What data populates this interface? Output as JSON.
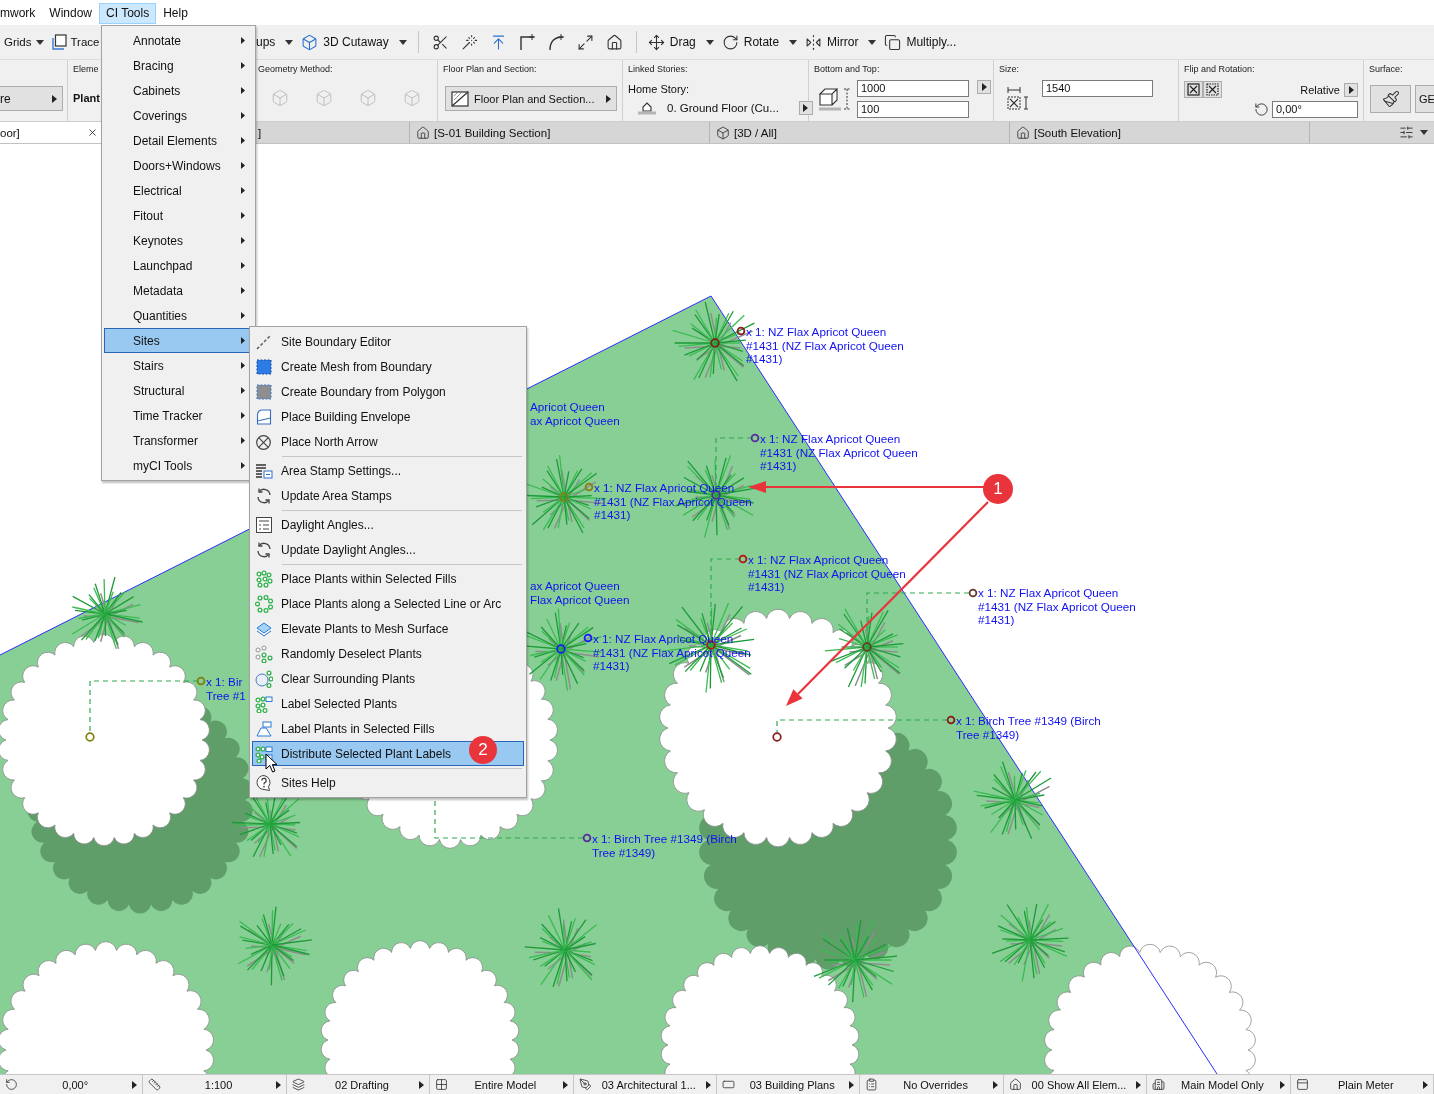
{
  "menu_bar": [
    {
      "label": "mwork",
      "selected": false
    },
    {
      "label": "Window",
      "selected": false
    },
    {
      "label": "CI Tools",
      "selected": true
    },
    {
      "label": "Help",
      "selected": false
    }
  ],
  "toolbar": [
    {
      "label": "Grids",
      "dropdown": true
    },
    {
      "label": "Trace",
      "dropdown": false
    },
    {
      "label": "ups",
      "dropdown": true
    },
    {
      "label": "3D Cutaway",
      "dropdown": true
    },
    {
      "label": "Drag",
      "dropdown": true
    },
    {
      "label": "Rotate",
      "dropdown": true
    },
    {
      "label": "Mirror",
      "dropdown": true
    },
    {
      "label": "Multiply...",
      "dropdown": false
    }
  ],
  "info_box": [
    {
      "kind": "selector",
      "value": "re"
    },
    {
      "kind": "element",
      "heading": "Eleme",
      "value": "Plant"
    },
    {
      "kind": "geometry",
      "heading": "Geometry Method:",
      "disabled": true
    },
    {
      "kind": "popup",
      "heading": "Floor Plan and Section:",
      "value": "Floor Plan and Section..."
    },
    {
      "kind": "story",
      "heading": "Linked Stories:",
      "label": "Home Story:",
      "value": "0. Ground Floor (Cu..."
    },
    {
      "kind": "bottom_top",
      "heading": "Bottom and Top:",
      "fields": [
        "1000",
        "100"
      ]
    },
    {
      "kind": "size",
      "heading": "Size:",
      "fields": [
        "1540"
      ]
    },
    {
      "kind": "flip",
      "heading": "Flip and Rotation:",
      "mode": "Relative",
      "fields": [
        "0,00°"
      ]
    },
    {
      "kind": "surface",
      "heading": "Surface:",
      "value": "GE"
    }
  ],
  "tabs": [
    {
      "label": "oor]",
      "selected": true,
      "closable": true
    },
    {
      "label": "]",
      "selected": false,
      "closable": false
    },
    {
      "label": "[S-01 Building Section]",
      "selected": false,
      "closable": false
    },
    {
      "label": "[3D / All]",
      "selected": false,
      "closable": false
    },
    {
      "label": "[South Elevation]",
      "selected": false,
      "closable": false
    }
  ],
  "canvas": {
    "labels": [
      {
        "lines": [
          "x 1: NZ Flax Apricot Queen",
          "#1431 (NZ Flax Apricot Queen",
          "#1431)"
        ],
        "color": "#8b1a1a"
      },
      {
        "lines": [
          "Apricot Queen",
          "ax Apricot Queen"
        ]
      },
      {
        "lines": [
          "x 1: NZ Flax Apricot Queen",
          "#1431 (NZ Flax Apricot Queen",
          "#1431)"
        ],
        "color": "#5b2ca0"
      },
      {
        "lines": [
          "x 1: NZ Flax Apricot Queen",
          "#1431 (NZ Flax Apricot Queen",
          "#1431)"
        ],
        "color": "#8a7d10"
      },
      {
        "lines": [
          "x 1: NZ Flax Apricot Queen",
          "#1431 (NZ Flax Apricot Queen",
          "#1431)"
        ],
        "color": "#b01818"
      },
      {
        "lines": [
          "x 1: NZ Flax Apricot Queen",
          "#1431 (NZ Flax Apricot Queen",
          "#1431)"
        ],
        "color": "#6b3a2a"
      },
      {
        "lines": [
          "ax Apricot Queen",
          "Flax Apricot Queen"
        ]
      },
      {
        "lines": [
          "x 1: NZ Flax Apricot Queen",
          "#1431 (NZ Flax Apricot Queen",
          "#1431)"
        ],
        "color": "#1a1aff"
      },
      {
        "lines": [
          "x 1: Bir",
          "Tree #1"
        ],
        "color": "#808010"
      },
      {
        "lines": [
          "x 1: Birch Tree #1349 (Birch",
          "Tree #1349)"
        ],
        "color": "#8b1a1a"
      },
      {
        "lines": [
          "x 1: Birch Tree #1349 (Birch",
          "Tree #1349)"
        ],
        "color": "#5b2ca0"
      }
    ]
  },
  "ci_tools_menu": [
    {
      "label": "Annotate",
      "submenu": true,
      "selected": false
    },
    {
      "label": "Bracing",
      "submenu": true,
      "selected": false
    },
    {
      "label": "Cabinets",
      "submenu": true,
      "selected": false
    },
    {
      "label": "Coverings",
      "submenu": true,
      "selected": false
    },
    {
      "label": "Detail Elements",
      "submenu": true,
      "selected": false
    },
    {
      "label": "Doors+Windows",
      "submenu": true,
      "selected": false
    },
    {
      "label": "Electrical",
      "submenu": true,
      "selected": false
    },
    {
      "label": "Fitout",
      "submenu": true,
      "selected": false
    },
    {
      "label": "Keynotes",
      "submenu": true,
      "selected": false
    },
    {
      "label": "Launchpad",
      "submenu": true,
      "selected": false
    },
    {
      "label": "Metadata",
      "submenu": true,
      "selected": false
    },
    {
      "label": "Quantities",
      "submenu": true,
      "selected": false
    },
    {
      "label": "Sites",
      "submenu": true,
      "selected": true
    },
    {
      "label": "Stairs",
      "submenu": true,
      "selected": false
    },
    {
      "label": "Structural",
      "submenu": true,
      "selected": false
    },
    {
      "label": "Time Tracker",
      "submenu": true,
      "selected": false
    },
    {
      "label": "Transformer",
      "submenu": true,
      "selected": false
    },
    {
      "label": "myCI Tools",
      "submenu": true,
      "selected": false
    }
  ],
  "sites_submenu": {
    "sections": [
      {
        "items": [
          {
            "label": "Site Boundary Editor",
            "selected": false
          },
          {
            "label": "Create Mesh from Boundary",
            "selected": false
          },
          {
            "label": "Create Boundary from Polygon",
            "selected": false
          },
          {
            "label": "Place Building Envelope",
            "selected": false
          },
          {
            "label": "Place North Arrow",
            "selected": false
          }
        ]
      },
      {
        "items": [
          {
            "label": "Area Stamp Settings...",
            "selected": false
          },
          {
            "label": "Update Area Stamps",
            "selected": false
          }
        ]
      },
      {
        "items": [
          {
            "label": "Daylight Angles...",
            "selected": false
          },
          {
            "label": "Update Daylight Angles...",
            "selected": false
          }
        ]
      },
      {
        "items": [
          {
            "label": "Place Plants within Selected Fills",
            "selected": false
          },
          {
            "label": "Place Plants along a Selected Line or Arc",
            "selected": false
          },
          {
            "label": "Elevate Plants to Mesh Surface",
            "selected": false
          },
          {
            "label": "Randomly Deselect Plants",
            "selected": false
          },
          {
            "label": "Clear Surrounding Plants",
            "selected": false
          },
          {
            "label": "Label Selected Plants",
            "selected": false
          },
          {
            "label": "Label Plants in Selected Fills",
            "selected": false
          },
          {
            "label": "Distribute Selected Plant Labels",
            "selected": true
          }
        ]
      },
      {
        "items": [
          {
            "label": "Sites Help",
            "selected": false
          }
        ]
      }
    ]
  },
  "callouts": [
    "1",
    "2"
  ],
  "status_bar": [
    "0,00°",
    "1:100",
    "02 Drafting",
    "Entire Model",
    "03 Architectural 1...",
    "03 Building Plans",
    "No Overrides",
    "00 Show All Elem...",
    "Main Model Only",
    "Plain Meter"
  ]
}
